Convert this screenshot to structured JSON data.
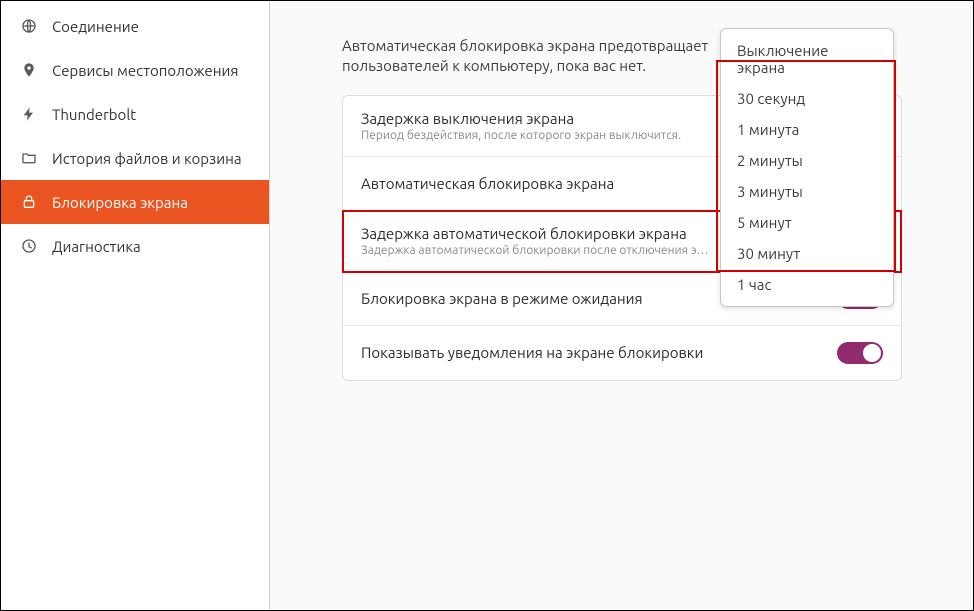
{
  "sidebar": {
    "items": [
      {
        "label": "Соединение"
      },
      {
        "label": "Сервисы местоположения"
      },
      {
        "label": "Thunderbolt"
      },
      {
        "label": "История файлов и корзина"
      },
      {
        "label": "Блокировка экрана"
      },
      {
        "label": "Диагностика"
      }
    ]
  },
  "main": {
    "intro_line1": "Автоматическая блокировка экрана предотвращает",
    "intro_line2": "пользователей к компьютеру, пока вас нет.",
    "rows": {
      "r1_title": "Задержка выключения экрана",
      "r1_sub": "Период бездействия, после которого экран выключится.",
      "r2_title": "Автоматическая блокировка экрана",
      "r3_title": "Задержка автоматической блокировки экрана",
      "r3_sub": "Задержка автоматической блокировки после отключения э…",
      "r4_title": "Блокировка экрана в режиме ожидания",
      "r5_title": "Показывать уведомления на экране блокировки"
    }
  },
  "dropdown": {
    "items": [
      "Выключение экрана",
      "30 секунд",
      "1 минута",
      "2 минуты",
      "3 минуты",
      "5 минут",
      "30 минут",
      "1 час"
    ]
  }
}
